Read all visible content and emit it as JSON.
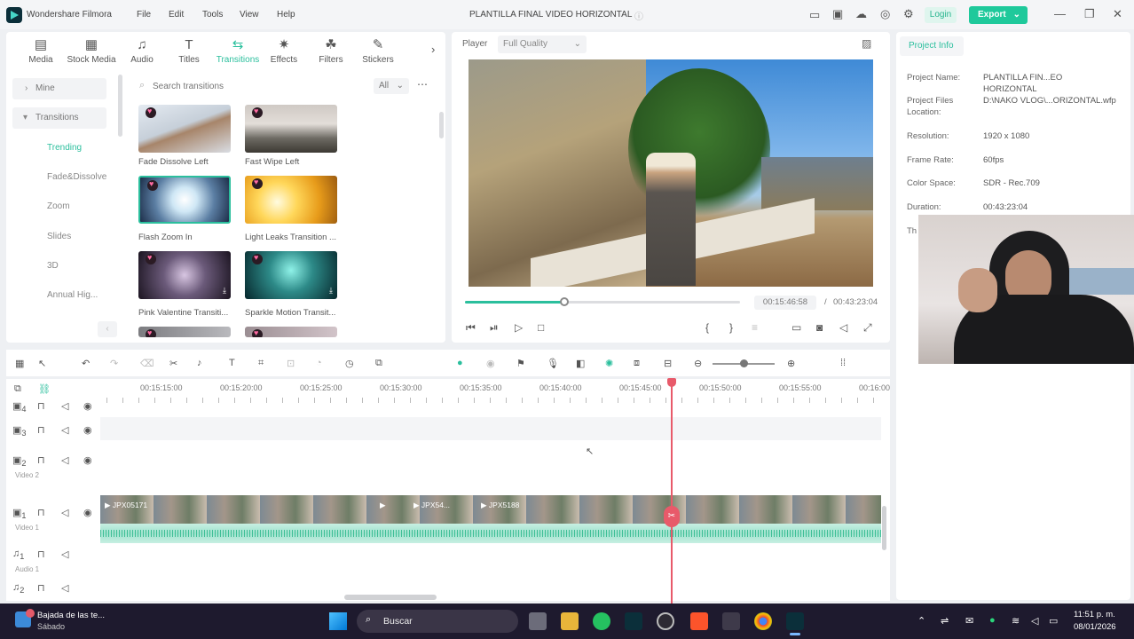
{
  "titlebar": {
    "app_name": "Wondershare Filmora",
    "menu": [
      "File",
      "Edit",
      "Tools",
      "View",
      "Help"
    ],
    "project_title": "PLANTILLA FINAL VIDEO HORIZONTAL",
    "login": "Login",
    "export": "Export"
  },
  "toolbar": {
    "tools": [
      {
        "label": "Media",
        "icon": "media-icon"
      },
      {
        "label": "Stock Media",
        "icon": "stock-media-icon"
      },
      {
        "label": "Audio",
        "icon": "audio-icon"
      },
      {
        "label": "Titles",
        "icon": "titles-icon"
      },
      {
        "label": "Transitions",
        "icon": "transitions-icon"
      },
      {
        "label": "Effects",
        "icon": "effects-icon"
      },
      {
        "label": "Filters",
        "icon": "filters-icon"
      },
      {
        "label": "Stickers",
        "icon": "stickers-icon"
      }
    ],
    "active": "Transitions"
  },
  "sidebar": {
    "mine": "Mine",
    "transitions": "Transitions",
    "items": [
      "Trending",
      "Fade&Dissolve",
      "Zoom",
      "Slides",
      "3D",
      "Annual Hig..."
    ],
    "selected": "Trending"
  },
  "search": {
    "placeholder": "Search transitions",
    "filter": "All"
  },
  "transitions": [
    {
      "name": "Fade Dissolve Left"
    },
    {
      "name": "Fast Wipe Left"
    },
    {
      "name": "Flash Zoom In"
    },
    {
      "name": "Light Leaks Transition ..."
    },
    {
      "name": "Pink Valentine Transiti..."
    },
    {
      "name": "Sparkle Motion Transit..."
    }
  ],
  "player": {
    "label": "Player",
    "quality": "Full Quality",
    "current_time": "00:15:46:58",
    "separator": "/",
    "total_time": "00:43:23:04",
    "progress": 0.36
  },
  "project_info": {
    "tab": "Project Info",
    "fields": [
      {
        "key": "Project Name:",
        "value": "PLANTILLA FIN...EO HORIZONTAL"
      },
      {
        "key": "Project Files Location:",
        "value": "D:\\NAKO VLOG\\...ORIZONTAL.wfp"
      },
      {
        "key": "Resolution:",
        "value": "1920 x 1080"
      },
      {
        "key": "Frame Rate:",
        "value": "60fps"
      },
      {
        "key": "Color Space:",
        "value": "SDR - Rec.709"
      },
      {
        "key": "Duration:",
        "value": "00:43:23:04"
      }
    ],
    "partial": "Th"
  },
  "timeline": {
    "ruler": [
      "00:15:15:00",
      "00:15:20:00",
      "00:15:25:00",
      "00:15:30:00",
      "00:15:35:00",
      "00:15:40:00",
      "00:15:45:00",
      "00:15:50:00",
      "00:15:55:00",
      "00:16:00"
    ],
    "tracks": {
      "video2": "Video 2",
      "video1": "Video 1",
      "audio1": "Audio 1"
    },
    "track_nums": [
      "4",
      "3",
      "2",
      "1",
      "1",
      "2"
    ],
    "clips": [
      "JPX05171",
      "JPX54...",
      "JPX5188"
    ]
  },
  "taskbar": {
    "notification_title": "Bajada de las te...",
    "notification_sub": "Sábado",
    "search": "Buscar",
    "time": "11:51 p. m.",
    "date": "08/01/2026"
  },
  "colors": {
    "accent": "#2bbf9d",
    "playhead": "#e85a6a",
    "export": "#1fc99b"
  }
}
